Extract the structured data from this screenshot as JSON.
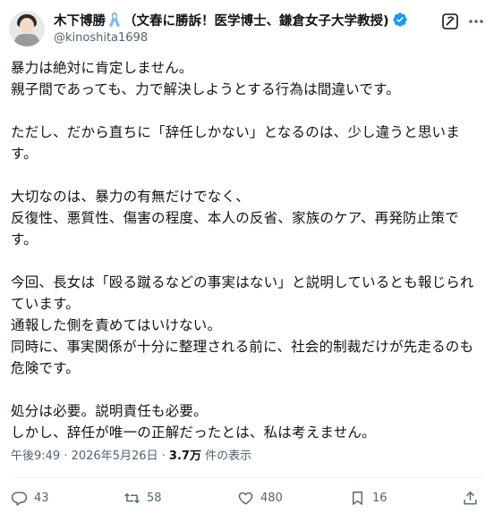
{
  "author": {
    "name": "木下博勝",
    "title_suffix": "（文春に勝訴！医学博士、鎌倉女子大学教授)",
    "handle": "@kinoshita1698"
  },
  "icons": {
    "ribbon": "awareness-ribbon-icon",
    "verified": "verified-badge-icon",
    "grok": "grok-icon",
    "more": "more-options-icon",
    "reply": "reply-icon",
    "retweet": "retweet-icon",
    "like": "heart-icon",
    "bookmark": "bookmark-icon",
    "share": "share-icon"
  },
  "colors": {
    "verified": "#1d9bf0",
    "ribbon": "#7fb8e6",
    "muted": "#536471",
    "text": "#0f1419"
  },
  "tweet": {
    "lines": [
      "暴力は絶対に肯定しません。",
      "親子間であっても、力で解決しようとする行為は間違いです。",
      "",
      "ただし、だから直ちに「辞任しかない」となるのは、少し違うと思いま",
      "す。",
      "",
      "大切なのは、暴力の有無だけでなく、",
      "反復性、悪質性、傷害の程度、本人の反省、家族のケア、再発防止策で",
      "す。",
      "",
      "今回、長女は「殴る蹴るなどの事実はない」と説明しているとも報じられ",
      "ています。",
      "通報した側を責めてはいけない。",
      "同時に、事実関係が十分に整理される前に、社会的制裁だけが先走るのも",
      "危険です。",
      "",
      "処分は必要。説明責任も必要。",
      "しかし、辞任が唯一の正解だったとは、私は考えません。"
    ]
  },
  "meta": {
    "time": "午後9:49",
    "date": "2026年5月26日",
    "views": "3.7万",
    "views_label": "件の表示"
  },
  "actions": {
    "replies": "43",
    "retweets": "58",
    "likes": "480",
    "bookmarks": "16"
  }
}
